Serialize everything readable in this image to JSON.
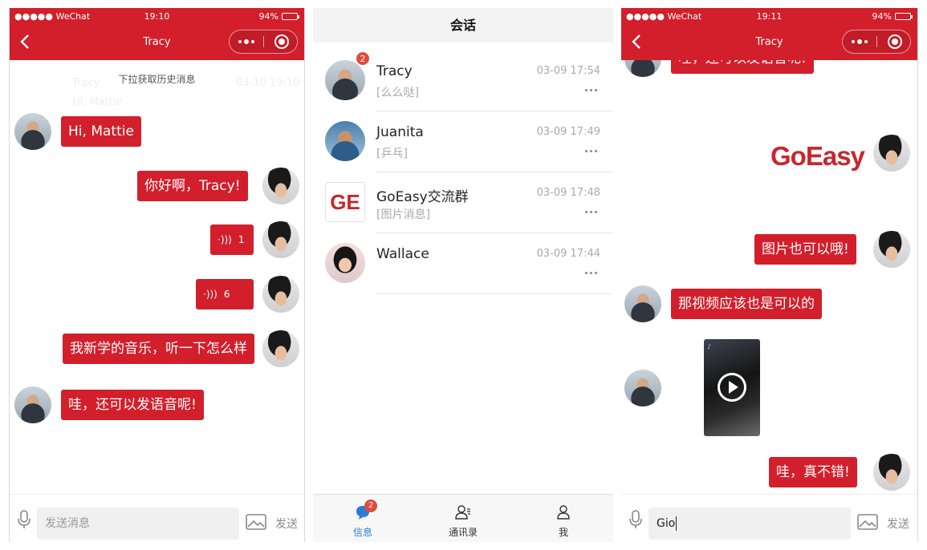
{
  "panel1": {
    "status": {
      "carrier": "●●●●● WeChat",
      "time": "19:10",
      "battery": "94%"
    },
    "nav_title": "Tracy",
    "history_hint": "下拉获取历史消息",
    "ghost": {
      "name": "Tracy",
      "preview": "Hi, Mattie",
      "time": "03-10 19:10"
    },
    "messages": [
      {
        "text": "Hi, Mattie"
      },
      {
        "text": "你好啊，Tracy!"
      },
      {
        "text": "1"
      },
      {
        "text": "6"
      },
      {
        "text": "我新学的音乐，听一下怎么样"
      },
      {
        "text": "哇，还可以发语音呢!"
      }
    ],
    "composer": {
      "placeholder": "发送消息",
      "send": "发送"
    }
  },
  "panel2": {
    "title": "会话",
    "conversations": [
      {
        "name": "Tracy",
        "time": "03-09 17:54",
        "preview": "[么么哒]",
        "badge": "2"
      },
      {
        "name": "Juanita",
        "time": "03-09 17:49",
        "preview": "[乒乓]"
      },
      {
        "name": "GoEasy交流群",
        "time": "03-09 17:48",
        "preview": "[图片消息]",
        "logo": "GE"
      },
      {
        "name": "Wallace",
        "time": "03-09 17:44",
        "preview": ""
      }
    ],
    "tabs": [
      {
        "label": "信息",
        "badge": "2"
      },
      {
        "label": "通讯录"
      },
      {
        "label": "我"
      }
    ],
    "colors": {
      "accent": "#2b7bd6",
      "badge": "#e04b3c"
    }
  },
  "panel3": {
    "status": {
      "carrier": "●●●●● WeChat",
      "time": "19:11",
      "battery": "94%"
    },
    "nav_title": "Tracy",
    "messages": [
      {
        "text": "哇，还可以发语音呢!"
      },
      {
        "text": "GoEasy"
      },
      {
        "text": "图片也可以哦!"
      },
      {
        "text": "那视频应该也是可以的"
      },
      {
        "text": "哇，真不错!"
      }
    ],
    "composer": {
      "value": "Gio",
      "send": "发送"
    }
  },
  "colors": {
    "brand_red": "#d21f2b",
    "logo_red": "#c8262d"
  },
  "icons": {
    "back": "chevron-left-icon",
    "more": "more-dots-icon",
    "close": "target-icon",
    "voice": "voice-wave-icon",
    "mic": "microphone-icon",
    "image": "image-icon",
    "play": "play-icon",
    "messages": "chat-bubble-icon",
    "contacts": "contacts-icon",
    "profile": "person-icon"
  }
}
